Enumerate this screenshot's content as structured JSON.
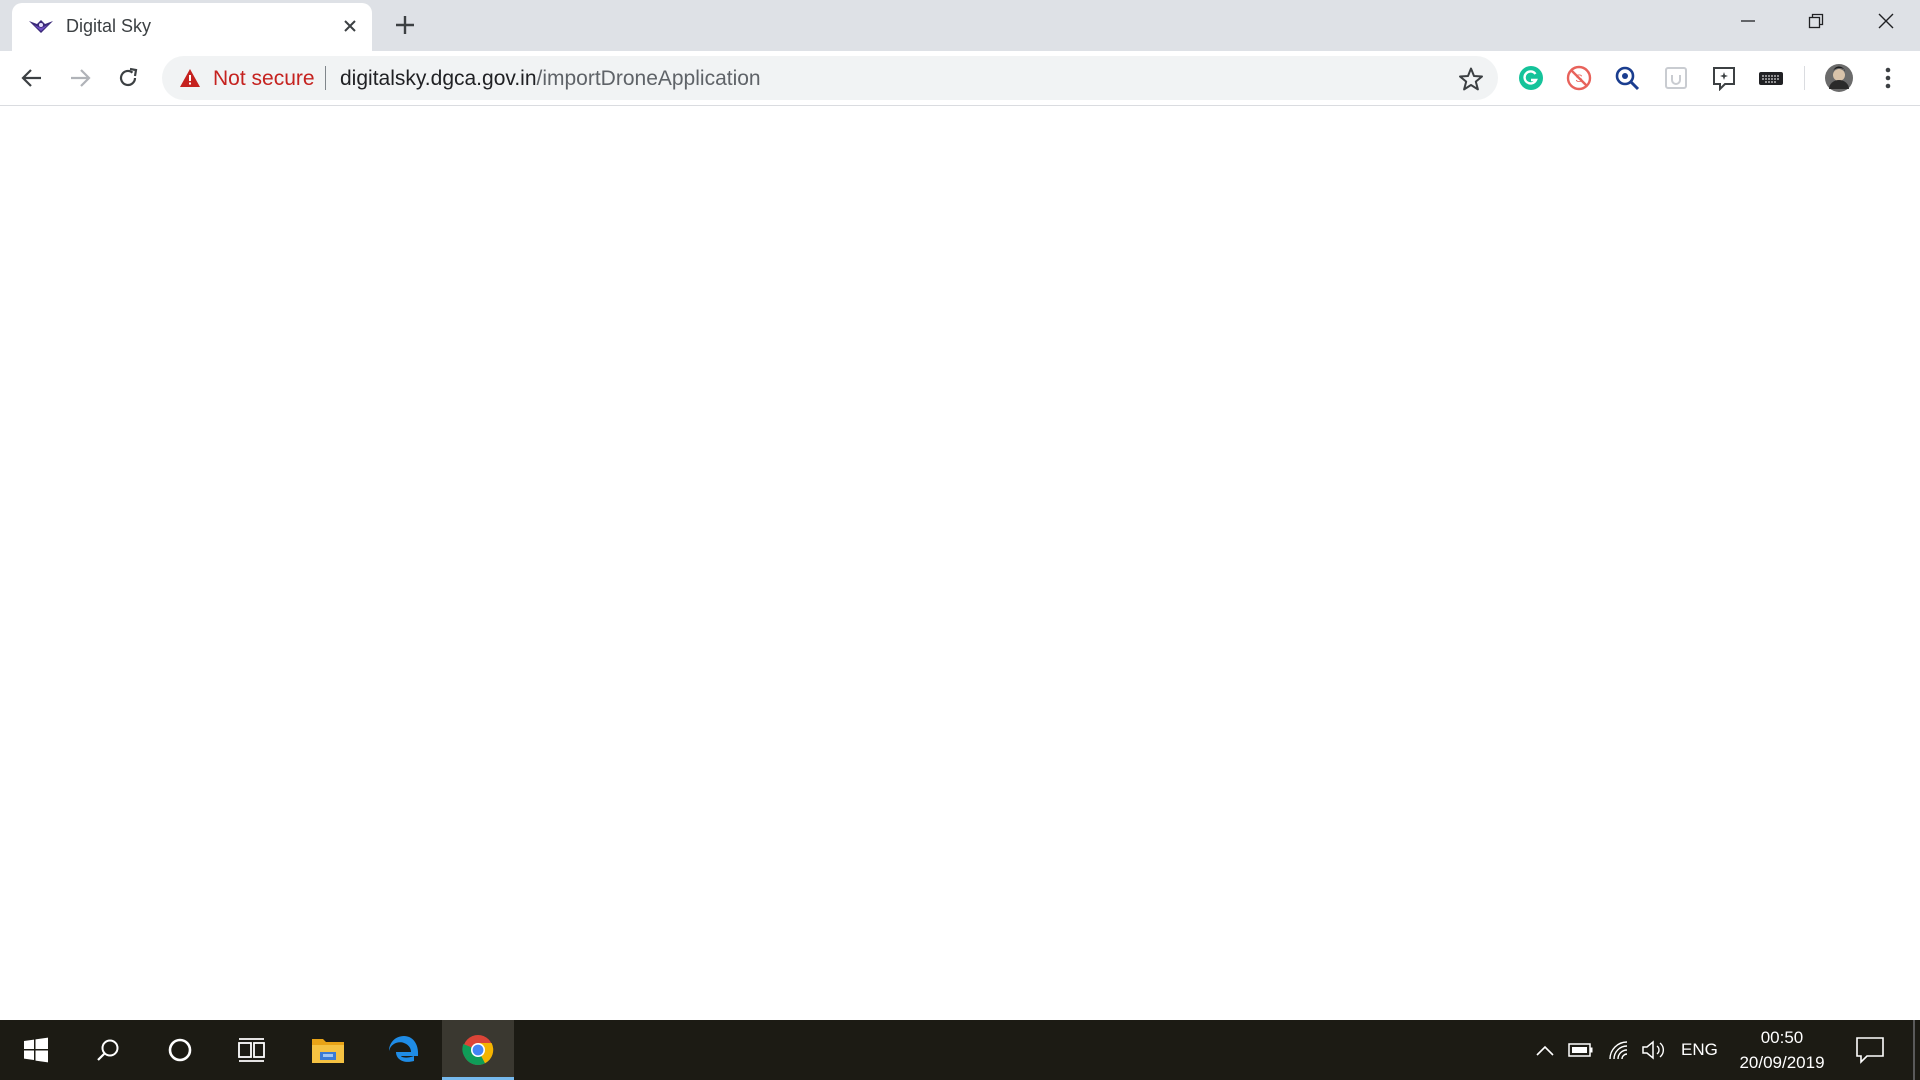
{
  "browser": {
    "tab": {
      "title": "Digital Sky",
      "favicon": "digital-sky-drone-icon"
    },
    "window_controls": [
      "minimize-icon",
      "restore-icon",
      "close-icon"
    ],
    "omnibox": {
      "security_label": "Not secure",
      "url_host": "digitalsky.dgca.gov.in",
      "url_path": "/importDroneApplication"
    },
    "extensions": [
      "grammarly-icon",
      "block-site-icon",
      "search-lens-icon",
      "clipboard-icon",
      "bookmark-sparkle-icon",
      "keyboard-icon",
      "profile-avatar-icon",
      "menu-dots-icon"
    ],
    "colors": {
      "warning": "#c5221f",
      "tabstrip": "#dee1e6",
      "omnibox": "#f1f3f4"
    }
  },
  "taskbar": {
    "apps": [
      "windows-start-icon",
      "search-icon",
      "cortana-icon",
      "task-view-icon",
      "file-explorer-icon",
      "edge-icon",
      "chrome-icon"
    ],
    "active_app": "chrome-icon",
    "tray": {
      "language": "ENG",
      "time": "00:50",
      "date": "20/09/2019"
    }
  }
}
